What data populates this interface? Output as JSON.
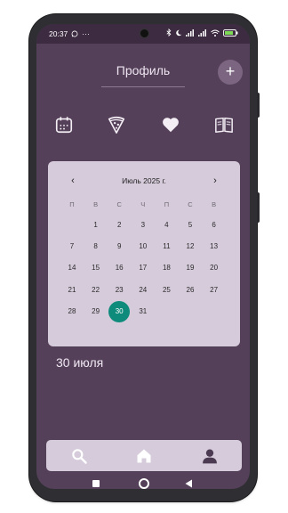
{
  "status_bar": {
    "time": "20:37",
    "more": "···"
  },
  "header": {
    "title": "Профиль",
    "add_label": "+"
  },
  "icons": [
    "calendar-icon",
    "pizza-icon",
    "heart-icon",
    "book-icon"
  ],
  "calendar": {
    "month_title": "Июль 2025 г.",
    "prev": "‹",
    "next": "›",
    "weekdays": [
      "П",
      "В",
      "С",
      "Ч",
      "П",
      "С",
      "В"
    ],
    "weeks": [
      [
        "",
        "1",
        "2",
        "3",
        "4",
        "5",
        "6"
      ],
      [
        "7",
        "8",
        "9",
        "10",
        "11",
        "12",
        "13"
      ],
      [
        "14",
        "15",
        "16",
        "17",
        "18",
        "19",
        "20"
      ],
      [
        "21",
        "22",
        "23",
        "24",
        "25",
        "26",
        "27"
      ],
      [
        "28",
        "29",
        "30",
        "31",
        "",
        "",
        ""
      ]
    ],
    "selected": "30"
  },
  "selected_date_label": "30 июля",
  "bottom_nav": [
    "search-icon",
    "home-icon",
    "profile-icon"
  ],
  "colors": {
    "background": "#55405a",
    "card": "#d6cbdb",
    "accent": "#0f8b7c"
  }
}
